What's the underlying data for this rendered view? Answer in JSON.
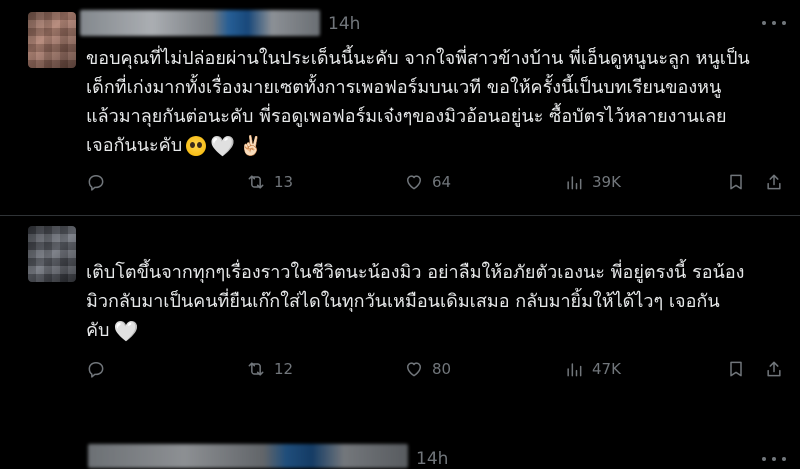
{
  "posts": [
    {
      "time": "14h",
      "lines": [
        "ขอบคุณที่ไม่ปล่อยผ่านในประเด็นนี้นะคับ จากใจพี่สาวข้างบ้าน พี่เอ็นดูหนูนะลูก หนูเป็น",
        "เด็กที่เก่งมากทั้งเรื่องมายเซตทั้งการเพอฟอร์มบนเวที ขอให้ครั้งนี้เป็นบทเรียนของหนู",
        "แล้วมาลุยกันต่อนะคับ พี่รอดูเพอฟอร์มเจ๋งๆของมิวอ้อนอยู่นะ ซื้อบัตรไว้หลายงานเลย",
        "เจอกันนะคับ"
      ],
      "emojis": [
        "pleading-face-emoji",
        "white-heart-emoji",
        "victory-hand-emoji"
      ],
      "heart_glyph": "🤍",
      "victory_glyph": "✌🏻",
      "replies": "",
      "reposts": "13",
      "likes": "64",
      "views": "39K"
    },
    {
      "time": "14h",
      "lines": [
        "เติบโตขึ้นจากทุกๆเรื่องราวในชีวิตนะน้องมิว อย่าลืมให้อภัยตัวเองนะ พี่อยู่ตรงนี้ รอน้อง",
        "มิวกลับมาเป็นคนที่ยืนเก๊กใส่ไดในทุกวันเหมือนเดิมเสมอ กลับมายิ้มให้ได้ไวๆ เจอกัน",
        "คับ"
      ],
      "emojis": [
        "white-heart-emoji"
      ],
      "heart_glyph": "🤍",
      "replies": "",
      "reposts": "12",
      "likes": "80",
      "views": "47K"
    }
  ],
  "icons": {
    "reply": "reply-icon",
    "repost": "repost-icon",
    "like": "like-icon",
    "views": "views-icon",
    "bookmark": "bookmark-icon",
    "share": "share-icon",
    "more": "more-icon"
  },
  "colors": {
    "background": "#000000",
    "text": "#e7e9ea",
    "muted": "#71767b",
    "divider": "#2f3336"
  }
}
